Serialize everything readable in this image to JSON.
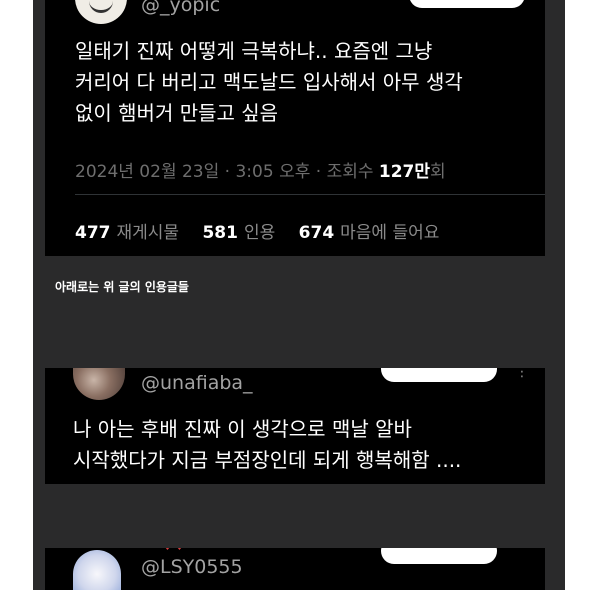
{
  "section_caption": "아래로는 위 글의 인용글들",
  "original_post": {
    "handle": "@_yopic",
    "text": "일태기 진짜 어떻게 극복하냐.. 요즘엔 그냥\n커리어 다 버리고 맥도날드 입사해서 아무 생각\n없이 햄버거 만들고 싶음",
    "date": "2024년 02월 23일",
    "time": "3:05 오후",
    "views_label": "조회수",
    "views_value": "127만",
    "views_unit": "회",
    "separator": "·",
    "stats": {
      "reposts_count": "477",
      "reposts_label": "재게시물",
      "quotes_count": "581",
      "quotes_label": "인용",
      "likes_count": "674",
      "likes_label": "마음에 들어요"
    }
  },
  "quote_1": {
    "handle": "@unafiaba_",
    "text": "나 아는 후배 진짜 이 생각으로 맥날 알바\n시작했다가 지금 부점장인데 되게 행복해함 ....",
    "more": "⋮",
    "name_fragment": "–"
  },
  "quote_2": {
    "handle": "@LSY0555",
    "name_fragment": "♥♥ ♥♥"
  },
  "colors": {
    "background": "#2a2a2b",
    "card": "#000000",
    "text": "#ffffff",
    "muted": "#6e6e6e"
  }
}
